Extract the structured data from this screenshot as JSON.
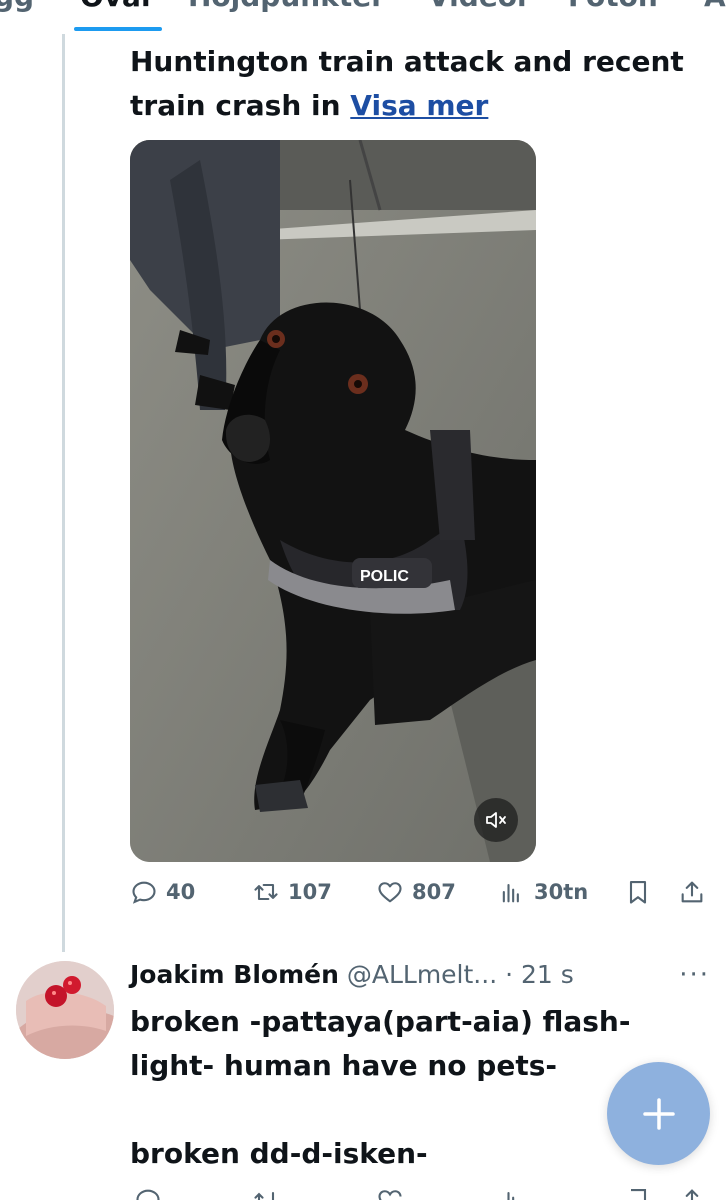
{
  "tabs": {
    "items": [
      "gg",
      "Övar",
      "Höjdpunkter",
      "Videor",
      "Foton",
      "A"
    ],
    "active_index": 1
  },
  "post": {
    "text": "Huntington train attack and recent train crash in",
    "link_label": "Visa mer",
    "video": {
      "badge": "POLIC",
      "mute_icon": "volume-muted-icon"
    },
    "actions": {
      "replies": "40",
      "reposts": "107",
      "likes": "807",
      "views": "30tn"
    }
  },
  "reply": {
    "name": "Joakim Blomén",
    "handle": "@ALLmelt...",
    "separator": "·",
    "time": "21 s",
    "more": "···",
    "text_lines": [
      "broken -pattaya(part-aia) flash-light- human have no pets-",
      "broken dd-d-isken-"
    ]
  },
  "fab": {
    "icon": "plus-icon"
  },
  "colors": {
    "accent": "#1d9bf0",
    "link": "#1d4ea3",
    "muted_text": "#536471",
    "fab": "#8eb1de"
  }
}
